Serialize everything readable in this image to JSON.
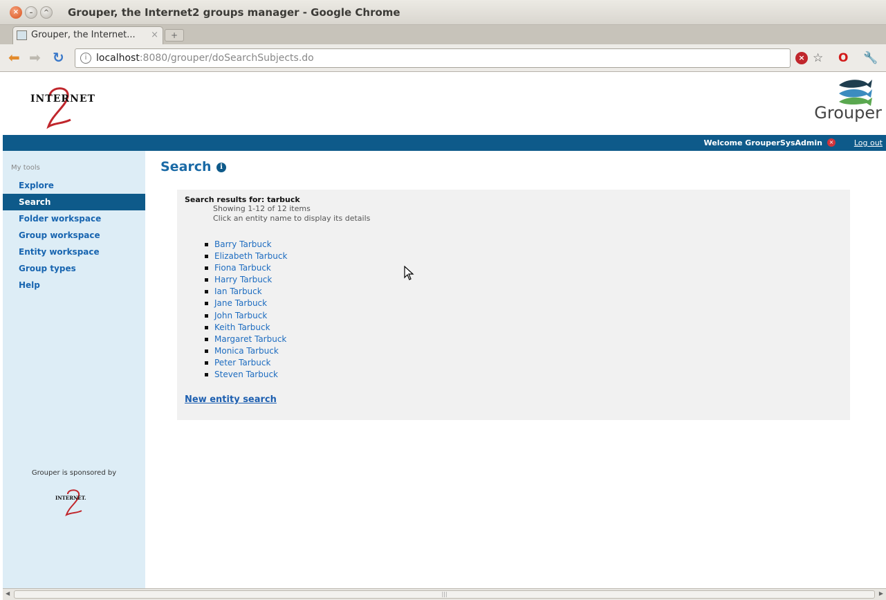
{
  "window": {
    "title": "Grouper, the Internet2 groups manager - Google Chrome",
    "tab_title": "Grouper, the Internet...",
    "tab_close": "×",
    "new_tab": "+"
  },
  "toolbar": {
    "url_host": "localhost",
    "url_rest": ":8080/grouper/doSearchSubjects.do"
  },
  "header": {
    "internet2_logo_text": "INTERNET",
    "grouper_logo_text": "Grouper"
  },
  "welcome_bar": {
    "welcome_text": "Welcome GrouperSysAdmin",
    "logout_label": "Log out"
  },
  "sidebar": {
    "heading": "My tools",
    "items": [
      {
        "label": "Explore",
        "active": false
      },
      {
        "label": "Search",
        "active": true
      },
      {
        "label": "Folder workspace",
        "active": false
      },
      {
        "label": "Group workspace",
        "active": false
      },
      {
        "label": "Entity workspace",
        "active": false
      },
      {
        "label": "Group types",
        "active": false
      },
      {
        "label": "Help",
        "active": false
      }
    ],
    "sponsor_text": "Grouper is sponsored by"
  },
  "main": {
    "title": "Search",
    "results_heading": "Search results for: tarbuck",
    "results_count": "Showing 1-12 of 12 items",
    "results_hint": "Click an entity name to display its details",
    "results": [
      "Barry Tarbuck",
      "Elizabeth Tarbuck",
      "Fiona Tarbuck",
      "Harry Tarbuck",
      "Ian Tarbuck",
      "Jane Tarbuck",
      "John Tarbuck",
      "Keith Tarbuck",
      "Margaret Tarbuck",
      "Monica Tarbuck",
      "Peter Tarbuck",
      "Steven Tarbuck"
    ],
    "new_search_label": "New entity search"
  },
  "colors": {
    "brand_blue": "#0e5a8a",
    "sidebar_bg": "#ddedf6",
    "link_blue": "#1d6cc0",
    "results_bg": "#f1f1f1"
  }
}
